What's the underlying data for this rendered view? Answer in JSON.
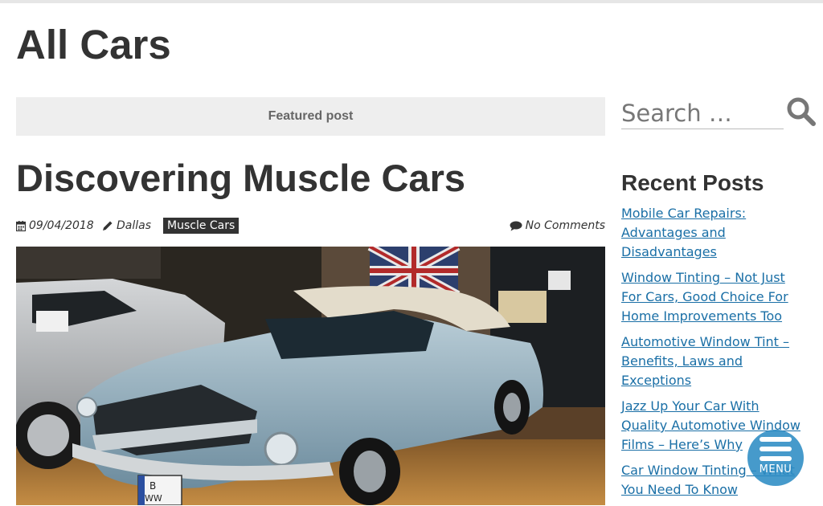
{
  "page": {
    "title": "All Cars"
  },
  "featured": {
    "label": "Featured post"
  },
  "post": {
    "title": "Discovering Muscle Cars",
    "date": "09/04/2018",
    "author": "Dallas",
    "category": "Muscle Cars",
    "comments": "No Comments",
    "icons": {
      "date": "calendar-icon",
      "author": "pencil-icon",
      "comments": "comment-icon"
    }
  },
  "search": {
    "placeholder": "Search …",
    "icon": "search-icon"
  },
  "sidebar": {
    "widget_title": "Recent Posts",
    "items": [
      {
        "label": "Mobile Car Repairs: Advantages and Disadvantages"
      },
      {
        "label": "Window Tinting – Not Just For Cars, Good Choice For Home Improvements Too"
      },
      {
        "label": "Automotive Window Tint – Benefits, Laws and Exceptions"
      },
      {
        "label": "Jazz Up Your Car With Quality Automotive Window Films – Here’s Why"
      },
      {
        "label": "Car Window Tinting – What You Need To Know"
      }
    ]
  },
  "menu": {
    "label": "MENU",
    "icon": "hamburger-icon"
  },
  "colors": {
    "link": "#1a6fa6",
    "menu": "#2c8cc4",
    "category_bg": "#333333"
  }
}
